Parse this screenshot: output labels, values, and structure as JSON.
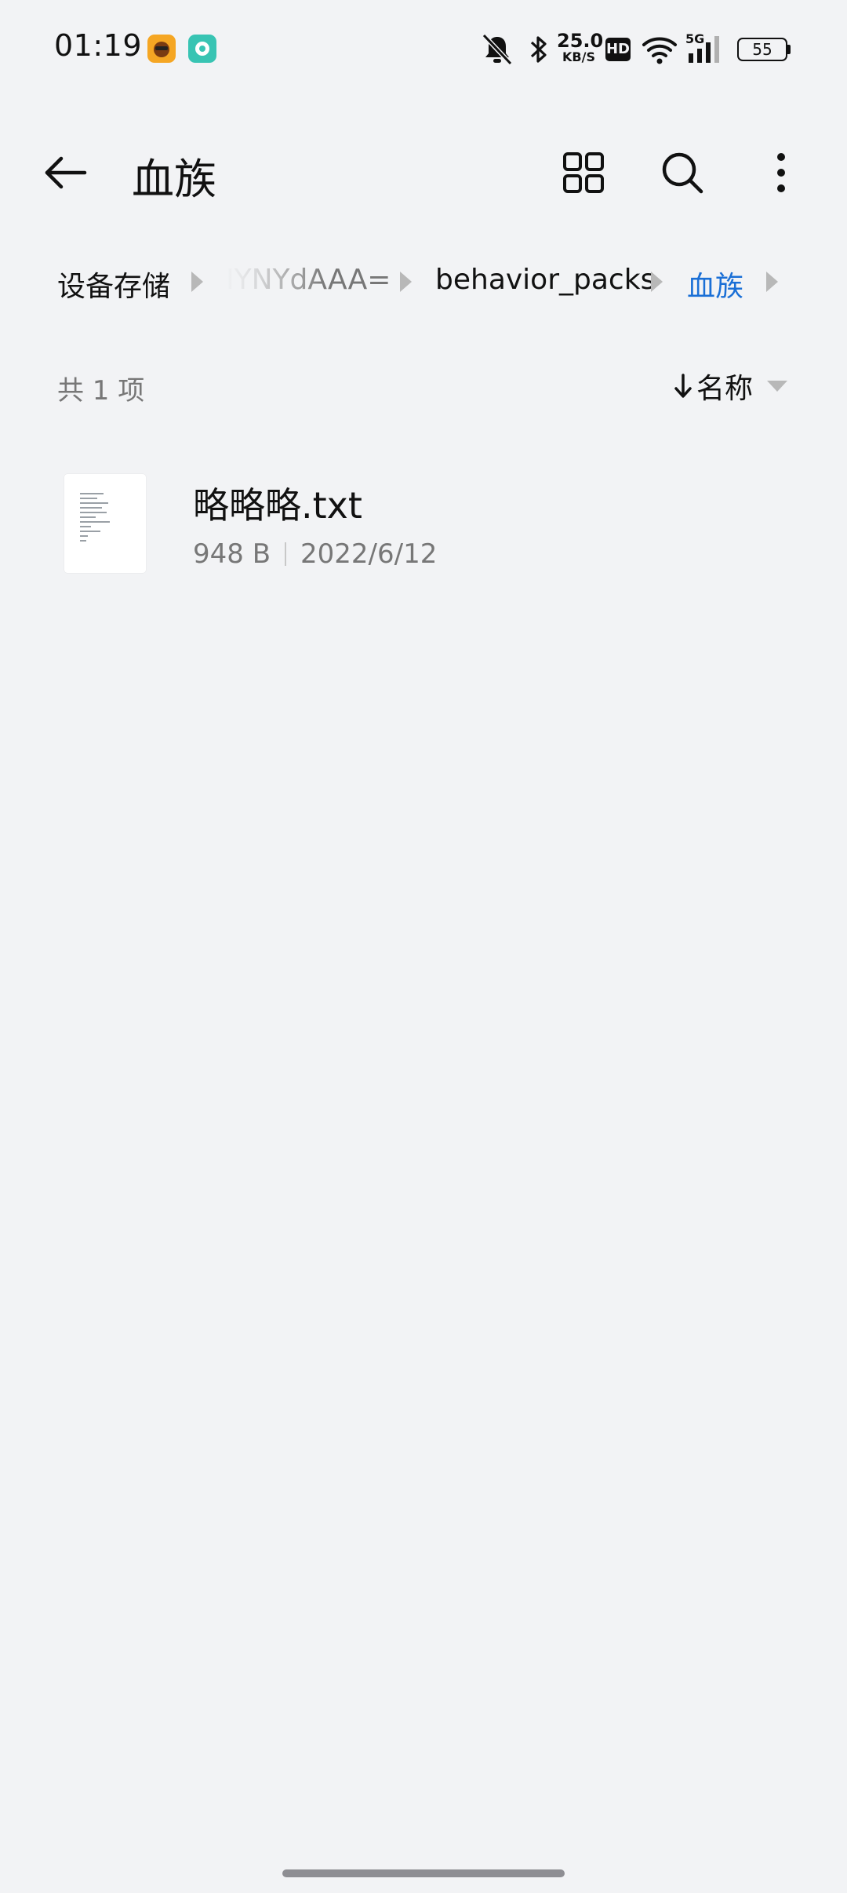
{
  "status_bar": {
    "time": "01:19",
    "net_speed_value": "25.0",
    "net_speed_unit": "KB/S",
    "hd_label": "HD",
    "network_label": "5G",
    "battery_level": "55"
  },
  "top_bar": {
    "title": "血族"
  },
  "breadcrumb": {
    "items": [
      {
        "label": "设备存储"
      },
      {
        "label": "IYNYdAAA="
      },
      {
        "label": "behavior_packs"
      },
      {
        "label": "血族"
      }
    ]
  },
  "list_header": {
    "item_count": "共 1 项",
    "sort_label": "名称"
  },
  "files": [
    {
      "name": "略略略.txt",
      "size": "948 B",
      "date": "2022/6/12"
    }
  ],
  "colors": {
    "background": "#f2f3f5",
    "accent": "#1a6fd6",
    "secondary_text": "#777777"
  }
}
